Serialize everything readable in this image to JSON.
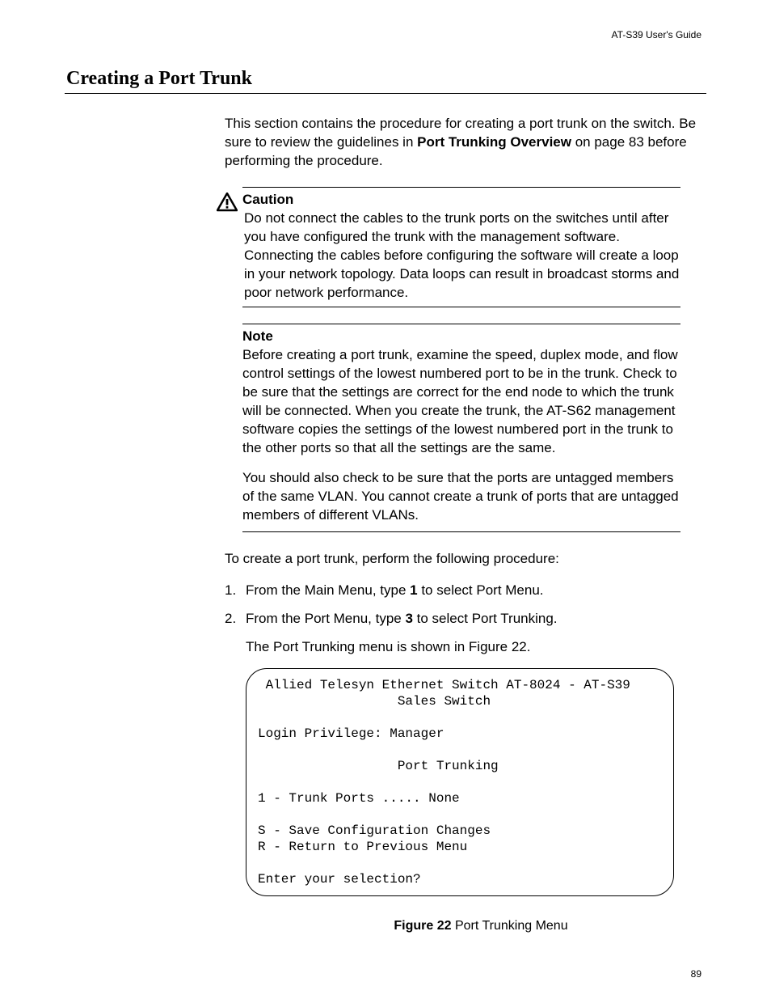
{
  "running_header": "AT-S39 User's Guide",
  "section_title": "Creating a Port Trunk",
  "intro": {
    "pre": "This section contains the procedure for creating a port trunk on the switch. Be sure to review the guidelines in ",
    "bold": "Port Trunking Overview",
    "post": " on page 83 before performing the procedure."
  },
  "caution": {
    "label": "Caution",
    "text": "Do not connect the cables to the trunk ports on the switches until after you have configured the trunk with the management software. Connecting the cables before configuring the software will create a loop in your network topology. Data loops can result in broadcast storms and poor network performance."
  },
  "note": {
    "label": "Note",
    "para1": "Before creating a port trunk, examine the speed, duplex mode, and flow control settings of the lowest numbered port to be in the trunk. Check to be sure that the settings are correct for the end node to which the trunk will be connected. When you create the trunk, the AT-S62 management software copies the settings of the lowest numbered port in the trunk to the other ports so that all the settings are the same.",
    "para2": "You should also check to be sure that the ports are untagged members of the same VLAN. You cannot create a trunk of ports that are untagged members of different VLANs."
  },
  "lead": "To create a port trunk, perform the following procedure:",
  "steps": [
    {
      "num": "1.",
      "pre": "From the Main Menu, type ",
      "bold": "1",
      "post": " to select Port Menu."
    },
    {
      "num": "2.",
      "pre": "From the Port Menu, type ",
      "bold": "3",
      "post": " to select Port Trunking."
    }
  ],
  "sub_line": "The Port Trunking menu is shown in Figure 22.",
  "terminal": " Allied Telesyn Ethernet Switch AT-8024 - AT-S39\n                  Sales Switch\n\nLogin Privilege: Manager\n\n                  Port Trunking\n\n1 - Trunk Ports ..... None\n\nS - Save Configuration Changes\nR - Return to Previous Menu\n\nEnter your selection?",
  "figure": {
    "bold": "Figure 22",
    "rest": "  Port Trunking Menu"
  },
  "page_number": "89"
}
